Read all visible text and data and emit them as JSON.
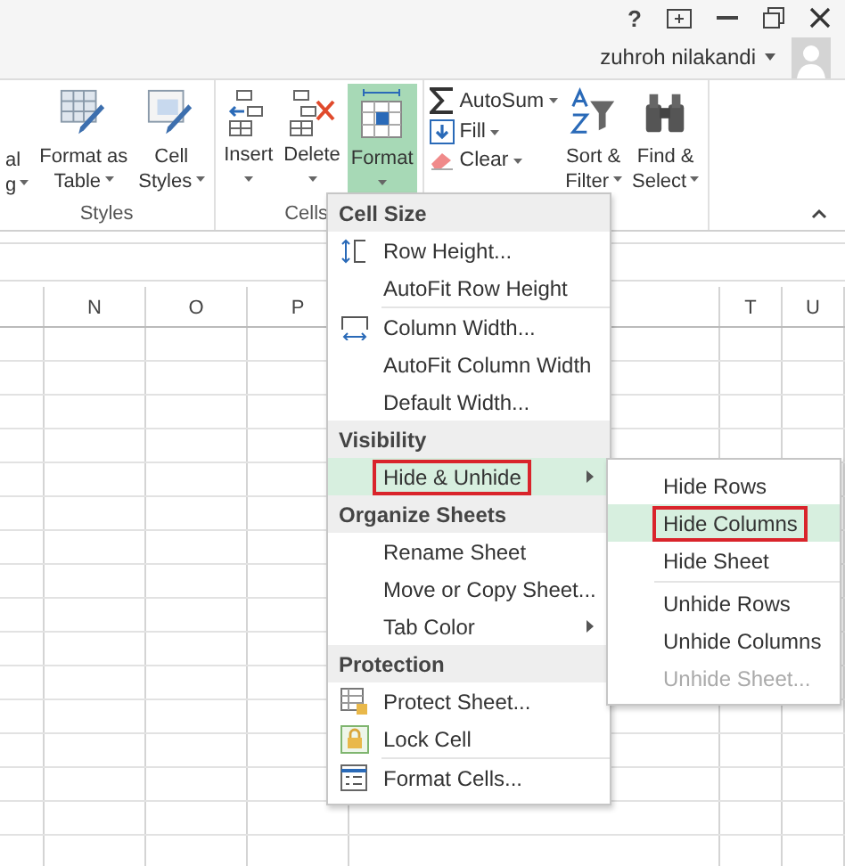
{
  "title_bar": {
    "help": "?"
  },
  "account": {
    "name": "zuhroh nilakandi"
  },
  "ribbon": {
    "groups": [
      {
        "label": "Styles",
        "buttons": [
          {
            "kind": "cut",
            "lines": [
              "al",
              "g"
            ],
            "dropdown": true
          },
          {
            "kind": "table",
            "lines": [
              "Format as",
              "Table"
            ],
            "dropdown": true
          },
          {
            "kind": "styles",
            "lines": [
              "Cell",
              "Styles"
            ],
            "dropdown": true
          }
        ]
      },
      {
        "label": "Cells",
        "buttons": [
          {
            "kind": "insert",
            "lines": [
              "Insert"
            ],
            "dropdown": true,
            "selected": false
          },
          {
            "kind": "delete",
            "lines": [
              "Delete"
            ],
            "dropdown": true,
            "selected": false
          },
          {
            "kind": "format",
            "lines": [
              "Format"
            ],
            "dropdown": true,
            "selected": true
          }
        ]
      },
      {
        "buttons": [
          {
            "kind": "small",
            "items": [
              {
                "kind": "sum",
                "label": "AutoSum",
                "dropdown": true
              },
              {
                "kind": "fill",
                "label": "Fill",
                "dropdown": true
              },
              {
                "kind": "clear",
                "label": "Clear",
                "dropdown": true
              }
            ]
          },
          {
            "kind": "sort",
            "lines": [
              "Sort &",
              "Filter"
            ],
            "dropdown": true
          },
          {
            "kind": "find",
            "lines": [
              "Find &",
              "Select"
            ],
            "dropdown": true
          }
        ]
      }
    ]
  },
  "sheet": {
    "columns": [
      "N",
      "O",
      "P",
      "T",
      "U"
    ]
  },
  "format_menu": {
    "sections": [
      {
        "header": "Cell Size",
        "groups": [
          [
            {
              "kind": "rowheight",
              "label": "Row Height...",
              "submenu": false,
              "highlighted": false,
              "boxed": false
            },
            {
              "kind": "plain",
              "label": "AutoFit Row Height",
              "submenu": false,
              "highlighted": false,
              "boxed": false
            }
          ],
          [
            {
              "kind": "colwidth",
              "label": "Column Width...",
              "submenu": false,
              "highlighted": false,
              "boxed": false
            },
            {
              "kind": "plain",
              "label": "AutoFit Column Width",
              "submenu": false,
              "highlighted": false,
              "boxed": false
            },
            {
              "kind": "plain",
              "label": "Default Width...",
              "submenu": false,
              "highlighted": false,
              "boxed": false
            }
          ]
        ]
      },
      {
        "header": "Visibility",
        "groups": [
          [
            {
              "kind": "plain",
              "label": "Hide & Unhide",
              "submenu": true,
              "highlighted": true,
              "boxed": true
            }
          ]
        ]
      },
      {
        "header": "Organize Sheets",
        "groups": [
          [
            {
              "kind": "plain",
              "label": "Rename Sheet",
              "submenu": false,
              "highlighted": false,
              "boxed": false
            },
            {
              "kind": "plain",
              "label": "Move or Copy Sheet...",
              "submenu": false,
              "highlighted": false,
              "boxed": false
            },
            {
              "kind": "plain",
              "label": "Tab Color",
              "submenu": true,
              "highlighted": false,
              "boxed": false
            }
          ]
        ]
      },
      {
        "header": "Protection",
        "groups": [
          [
            {
              "kind": "protect",
              "label": "Protect Sheet...",
              "submenu": false,
              "highlighted": false,
              "boxed": false
            },
            {
              "kind": "lock",
              "label": "Lock Cell",
              "submenu": false,
              "highlighted": false,
              "boxed": false
            }
          ],
          [
            {
              "kind": "formatcells",
              "label": "Format Cells...",
              "submenu": false,
              "highlighted": false,
              "boxed": false
            }
          ]
        ]
      }
    ]
  },
  "hide_unhide_menu": {
    "groups": [
      [
        {
          "label": "Hide Rows",
          "highlighted": false,
          "boxed": false,
          "disabled": false
        },
        {
          "label": "Hide Columns",
          "highlighted": true,
          "boxed": true,
          "disabled": false
        },
        {
          "label": "Hide Sheet",
          "highlighted": false,
          "boxed": false,
          "disabled": false
        }
      ],
      [
        {
          "label": "Unhide Rows",
          "highlighted": false,
          "boxed": false,
          "disabled": false
        },
        {
          "label": "Unhide Columns",
          "highlighted": false,
          "boxed": false,
          "disabled": false
        },
        {
          "label": "Unhide Sheet...",
          "highlighted": false,
          "boxed": false,
          "disabled": true
        }
      ]
    ]
  }
}
